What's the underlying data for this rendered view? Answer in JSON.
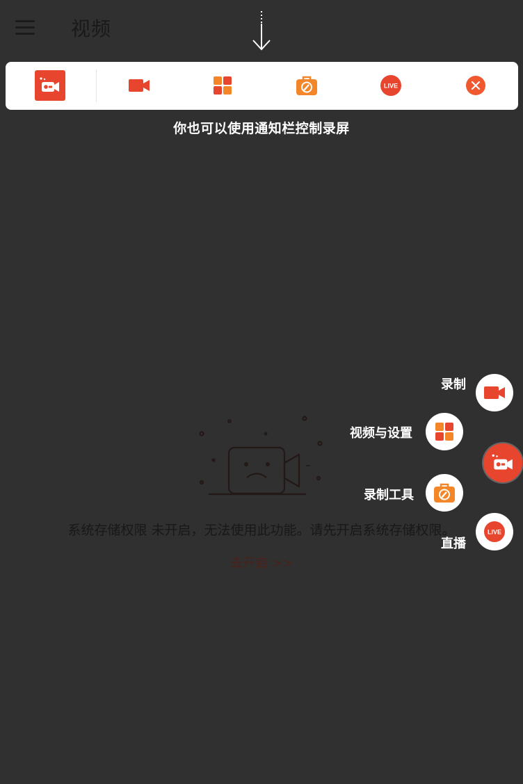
{
  "header": {
    "title": "视频"
  },
  "notification_bar": {
    "buttons": [
      "app",
      "record",
      "videos-settings",
      "tools",
      "live",
      "close"
    ]
  },
  "hint": "你也可以使用通知栏控制录屏",
  "empty_state": {
    "message": "系统存储权限 未开启，无法使用此功能。请先开启系统存储权限。",
    "action": "去开启 >>"
  },
  "float_menu": {
    "record_label": "录制",
    "videos_settings_label": "视频与设置",
    "tools_label": "录制工具",
    "live_label": "直播"
  },
  "icons": {
    "live_text": "LIVE"
  },
  "colors": {
    "accent": "#e8452f",
    "orange": "#f4862a",
    "background": "#2c2c2c"
  }
}
